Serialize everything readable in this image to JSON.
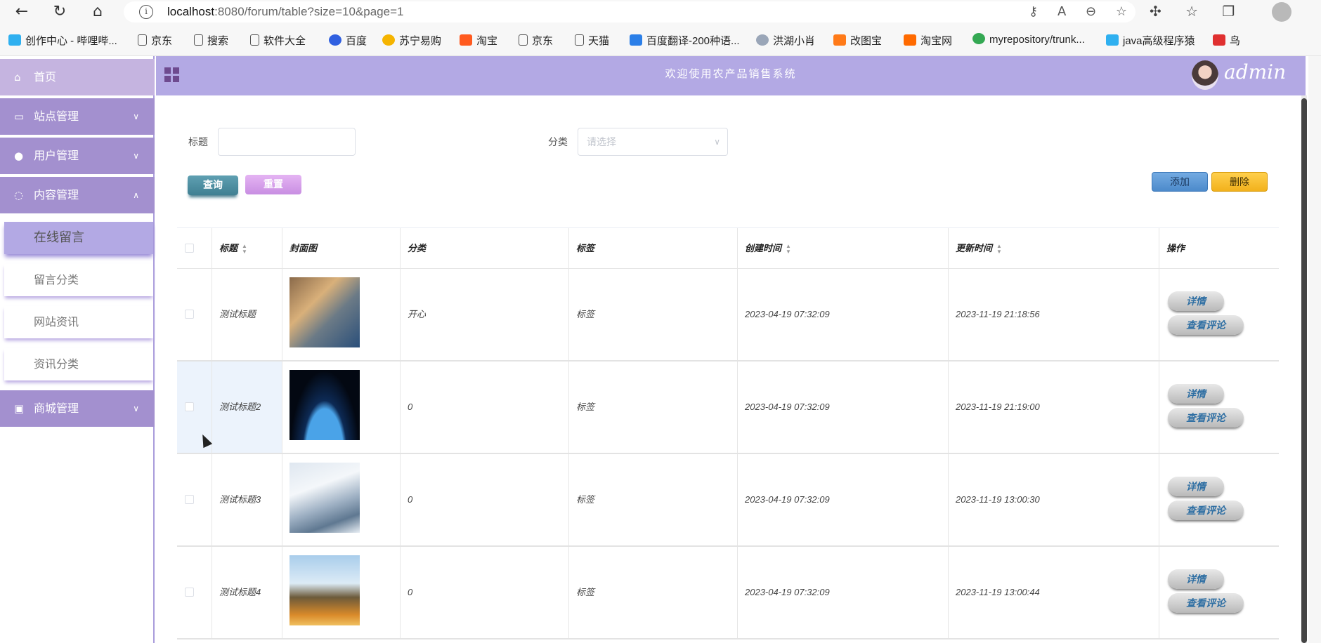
{
  "browser": {
    "url_host": "localhost",
    "url_rest": ":8080/forum/table?size=10&page=1",
    "bookmarks": [
      "创作中心 - 哔哩哔...",
      "京东",
      "搜索",
      "软件大全",
      "百度",
      "苏宁易购",
      "淘宝",
      "京东",
      "天猫",
      "百度翻译-200种语...",
      "洪湖小肖",
      "改图宝",
      "淘宝网",
      "myrepository/trunk...",
      "java高级程序猿",
      "鸟"
    ]
  },
  "sidebar": {
    "home": "首页",
    "site_mgmt": "站点管理",
    "user_mgmt": "用户管理",
    "content_mgmt": "内容管理",
    "sub_items": [
      "在线留言",
      "留言分类",
      "网站资讯",
      "资讯分类"
    ],
    "mall_mgmt": "商城管理"
  },
  "header": {
    "title": "欢迎使用农产品销售系统",
    "username": "admin"
  },
  "filters": {
    "title_label": "标题",
    "title_value": "",
    "category_label": "分类",
    "category_placeholder": "请选择",
    "query_label": "查询",
    "reset_label": "重置",
    "add_label": "添加",
    "delete_label": "删除"
  },
  "table": {
    "headers": [
      "标题",
      "封面图",
      "分类",
      "标签",
      "创建时间",
      "更新时间",
      "操作"
    ],
    "rows": [
      {
        "title": "测试标题",
        "category": "开心",
        "tag": "标签",
        "created": "2023-04-19 07:32:09",
        "updated": "2023-11-19 21:18:56"
      },
      {
        "title": "测试标题2",
        "category": "0",
        "tag": "标签",
        "created": "2023-04-19 07:32:09",
        "updated": "2023-11-19 21:19:00"
      },
      {
        "title": "测试标题3",
        "category": "0",
        "tag": "标签",
        "created": "2023-04-19 07:32:09",
        "updated": "2023-11-19 13:00:30"
      },
      {
        "title": "测试标题4",
        "category": "0",
        "tag": "标签",
        "created": "2023-04-19 07:32:09",
        "updated": "2023-11-19 13:00:44"
      }
    ],
    "detail_label": "详情",
    "comments_label": "查看评论"
  },
  "colors": {
    "sidebar_item": "#a390cf",
    "topbar": "#b3a9e4",
    "query_btn": "#4a8a9e",
    "reset_btn": "#d9a6ef",
    "add_btn": "#5b9ad8",
    "delete_btn": "#f7c02f"
  }
}
